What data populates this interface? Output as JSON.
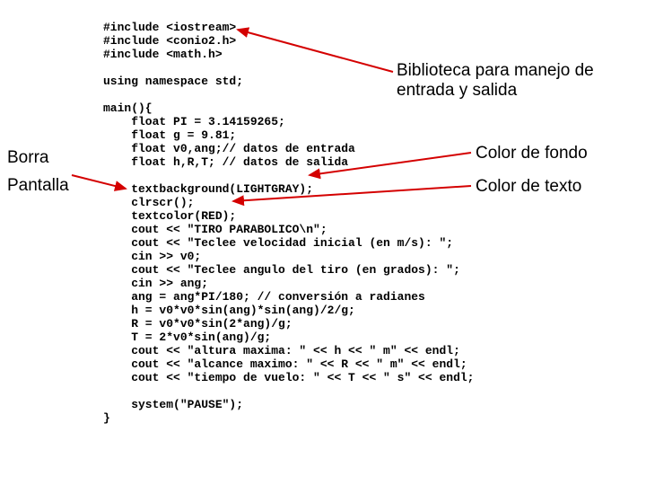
{
  "code": "#include <iostream>\n#include <conio2.h>\n#include <math.h>\n\nusing namespace std;\n\nmain(){\n    float PI = 3.14159265;\n    float g = 9.81;\n    float v0,ang;// datos de entrada\n    float h,R,T; // datos de salida\n\n    textbackground(LIGHTGRAY);\n    clrscr();\n    textcolor(RED);\n    cout << \"TIRO PARABOLICO\\n\";\n    cout << \"Teclee velocidad inicial (en m/s): \";\n    cin >> v0;\n    cout << \"Teclee angulo del tiro (en grados): \";\n    cin >> ang;\n    ang = ang*PI/180; // conversión a radianes\n    h = v0*v0*sin(ang)*sin(ang)/2/g;\n    R = v0*v0*sin(2*ang)/g;\n    T = 2*v0*sin(ang)/g;\n    cout << \"altura maxima: \" << h << \" m\" << endl;\n    cout << \"alcance maximo: \" << R << \" m\" << endl;\n    cout << \"tiempo de vuelo: \" << T << \" s\" << endl;\n\n    system(\"PAUSE\");\n}",
  "labels": {
    "left1": "Borra",
    "left2": "Pantalla",
    "right1a": "Biblioteca para manejo de",
    "right1b": "entrada y salida",
    "right2": "Color de fondo",
    "right3": "Color de texto"
  },
  "arrows": {
    "color": "#d40000"
  }
}
